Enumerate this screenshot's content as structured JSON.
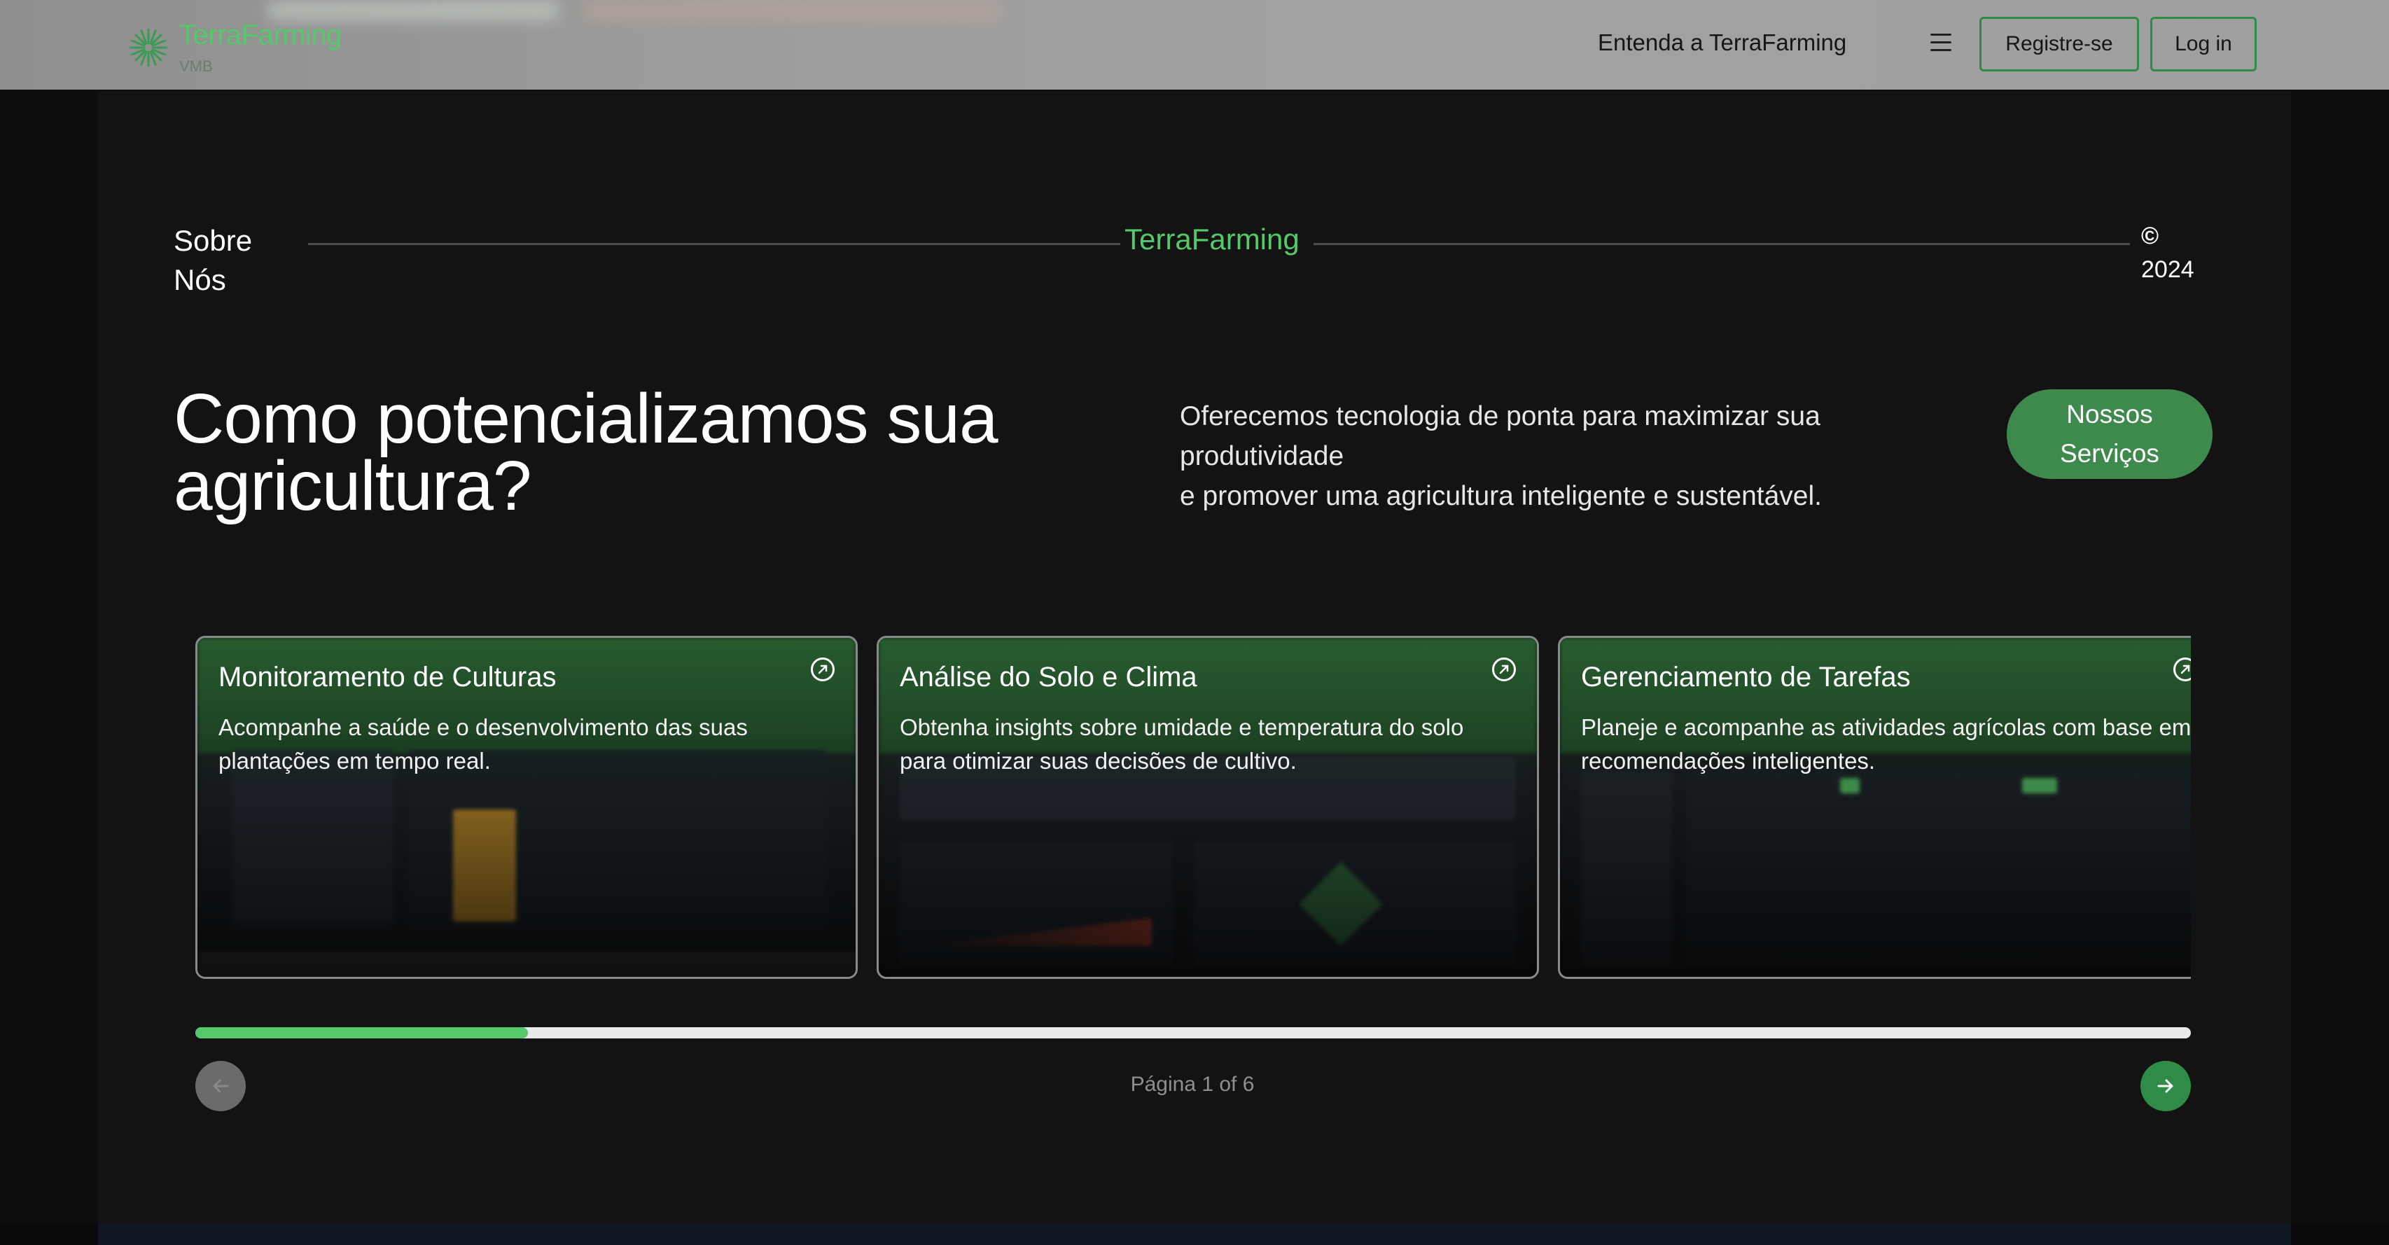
{
  "header": {
    "brand_name": "TerraFarming",
    "brand_sub": "VMB",
    "nav_link": "Entenda a TerraFarming",
    "register_label": "Registre-se",
    "login_label": "Log in",
    "icons": {
      "logo": "sunburst-logo-icon",
      "menu": "hamburger-menu-icon"
    },
    "colors": {
      "brand": "#55c86a",
      "outline": "#2f8c46"
    }
  },
  "about": {
    "label_line1": "Sobre",
    "label_line2": "Nós",
    "brand": "TerraFarming",
    "copyright_symbol": "©",
    "year": "2024"
  },
  "hero": {
    "title_line1": "Como potencializamos sua",
    "title_line2": "agricultura?",
    "desc_line1": "Oferecemos tecnologia de ponta para maximizar sua",
    "desc_line2": "produtividade",
    "desc_line3": "e promover uma agricultura inteligente e sustentável.",
    "cta_line1": "Nossos",
    "cta_line2": "Serviços"
  },
  "cards": [
    {
      "title": "Monitoramento de Culturas",
      "desc": "Acompanhe a saúde e o desenvolvimento das suas plantações em tempo real.",
      "icon": "external-arrow-icon"
    },
    {
      "title": "Análise do Solo e Clima",
      "desc": "Obtenha insights sobre umidade e temperatura do solo para otimizar suas decisões de cultivo.",
      "icon": "external-arrow-icon"
    },
    {
      "title": "Gerenciamento de Tarefas",
      "desc": "Planeje e acompanhe as atividades agrícolas com base em recomendações inteligentes.",
      "icon": "external-arrow-icon"
    }
  ],
  "carousel": {
    "progress_fraction": 0.1667,
    "page_text": "Página 1 of 6",
    "prev_icon": "arrow-left-icon",
    "next_icon": "arrow-right-icon"
  }
}
